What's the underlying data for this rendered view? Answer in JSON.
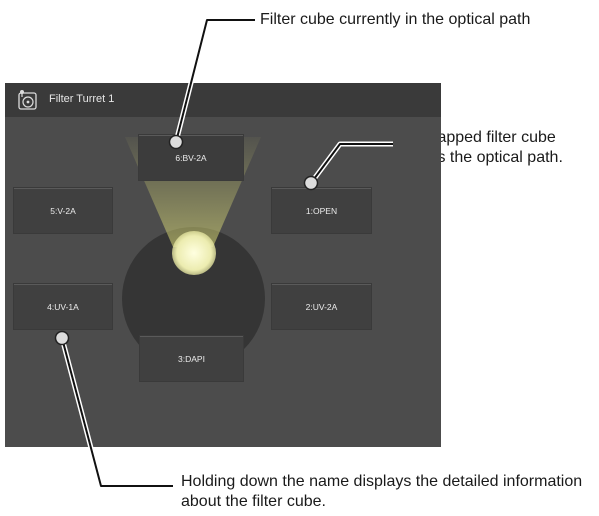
{
  "callouts": {
    "top": "Filter cube currently in the optical path",
    "right": "The tapped filter cube enters the optical path.",
    "bottom": "Holding down the name displays the detailed information about the filter cube."
  },
  "panel": {
    "title": "Filter Turret 1",
    "icon": "filter-turret-icon"
  },
  "filter_cubes": [
    {
      "position": 6,
      "label": "6:BV-2A",
      "in_optical_path": true
    },
    {
      "position": 5,
      "label": "5:V-2A",
      "in_optical_path": false
    },
    {
      "position": 1,
      "label": "1:OPEN",
      "in_optical_path": false
    },
    {
      "position": 4,
      "label": "4:UV-1A",
      "in_optical_path": false
    },
    {
      "position": 2,
      "label": "2:UV-2A",
      "in_optical_path": false
    },
    {
      "position": 3,
      "label": "3:DAPI",
      "in_optical_path": false
    }
  ],
  "colors": {
    "panel_background": "#505050",
    "header_background": "#3a3a3a",
    "button_background": "#404040",
    "beam_light": "#f5f5c8"
  }
}
